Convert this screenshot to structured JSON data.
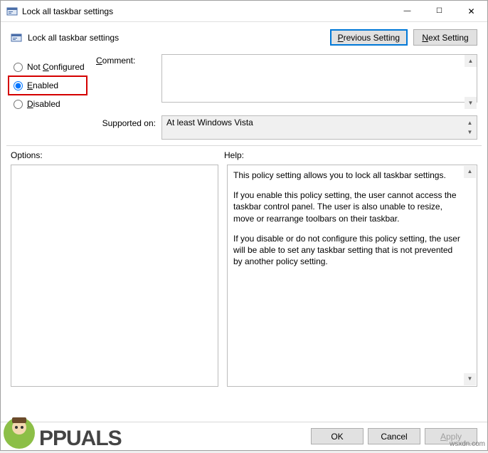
{
  "window": {
    "title": "Lock all taskbar settings",
    "minimize_icon": "—",
    "maximize_icon": "☐",
    "close_icon": "✕"
  },
  "header": {
    "policy_name": "Lock all taskbar settings",
    "previous_btn_prefix": "P",
    "previous_btn_rest": "revious Setting",
    "next_btn_prefix": "N",
    "next_btn_rest": "ext Setting"
  },
  "state": {
    "not_configured_prefix": "Not ",
    "not_configured_u": "C",
    "not_configured_rest": "onfigured",
    "enabled_u": "E",
    "enabled_rest": "nabled",
    "disabled_u": "D",
    "disabled_rest": "isabled",
    "selected": "enabled"
  },
  "comment": {
    "label_u": "C",
    "label_rest": "omment:",
    "value": ""
  },
  "supported": {
    "label": "Supported on:",
    "value": "At least Windows Vista"
  },
  "labels": {
    "options": "Options:",
    "help": "Help:"
  },
  "help": {
    "p1": "This policy setting allows you to lock all taskbar settings.",
    "p2": "If you enable this policy setting, the user cannot access the taskbar control panel. The user is also unable to resize, move or rearrange toolbars on their taskbar.",
    "p3": "If you disable or do not configure this policy setting, the user will be able to set any taskbar setting that is not prevented by another policy setting."
  },
  "buttons": {
    "ok": "OK",
    "cancel": "Cancel",
    "apply_u": "A",
    "apply_rest": "pply"
  },
  "watermark": {
    "text": "PPUALS",
    "origin": "wsxdn.com"
  }
}
